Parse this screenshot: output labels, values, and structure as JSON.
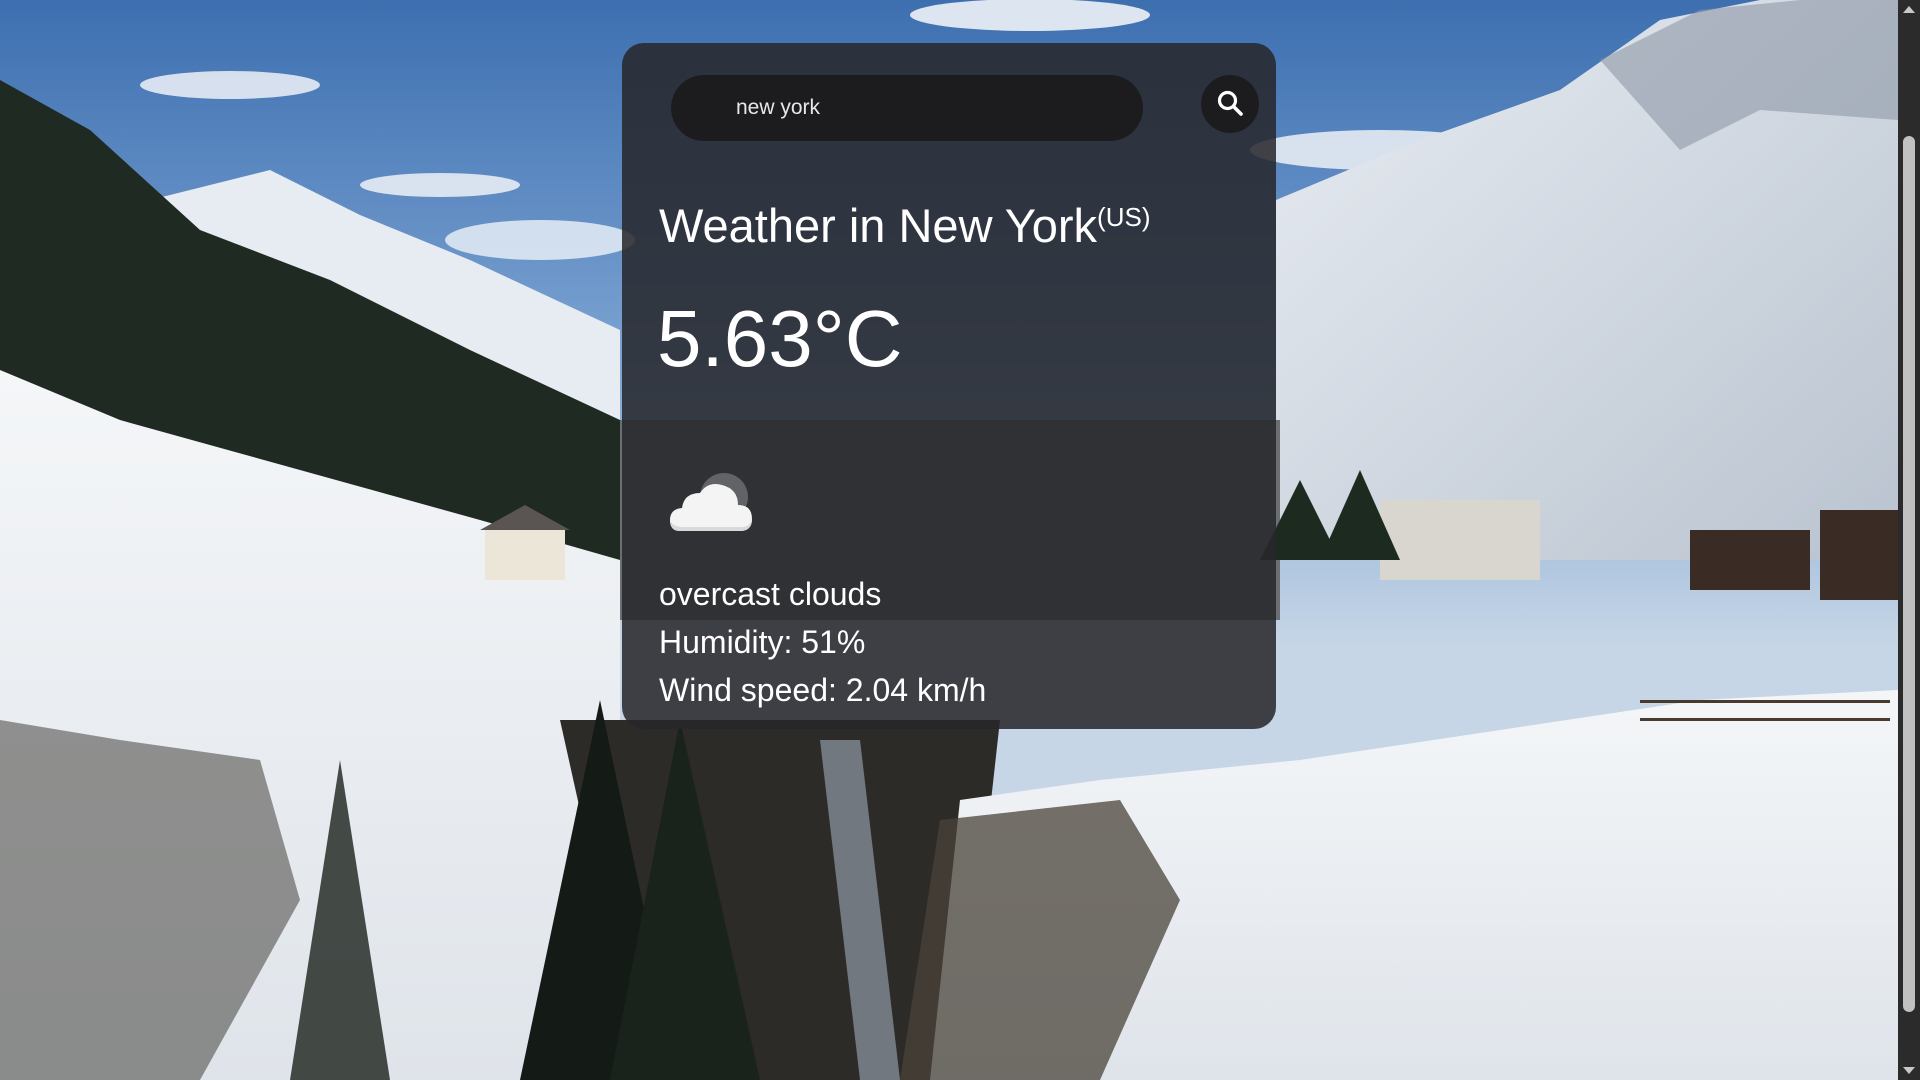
{
  "search": {
    "value": "new york",
    "placeholder": "Search"
  },
  "weather": {
    "title_prefix": "Weather in ",
    "city": "New York",
    "country": "(US)",
    "temperature": "5.63°C",
    "icon": "cloud-icon",
    "description": "overcast clouds",
    "humidity": "Humidity: 51%",
    "wind": "Wind speed: 2.04 km/h"
  },
  "icons": {
    "search_button": "search-icon",
    "weather": "cloud-icon"
  },
  "colors": {
    "card_bg": "#26262a",
    "search_bg": "#1c1c1f",
    "text": "#ffffff",
    "scrollbar_track": "#2b2b2b",
    "scrollbar_thumb": "#c1c1c1"
  }
}
